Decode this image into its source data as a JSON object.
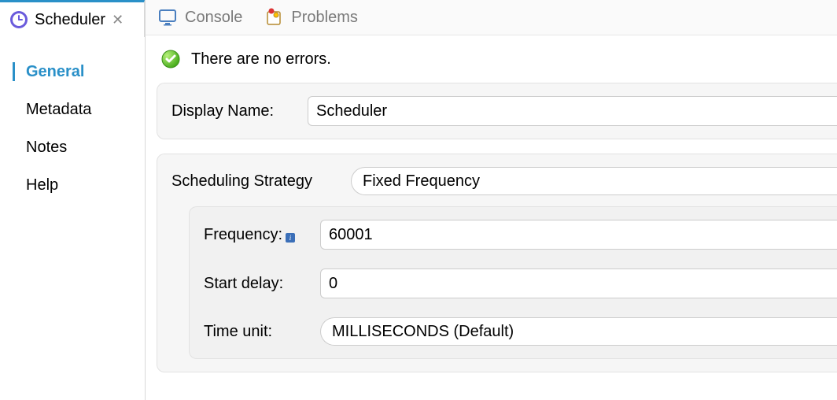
{
  "left": {
    "title": "Scheduler",
    "nav": {
      "general": "General",
      "metadata": "Metadata",
      "notes": "Notes",
      "help": "Help"
    }
  },
  "topTabs": {
    "console": "Console",
    "problems": "Problems"
  },
  "status": {
    "message": "There are no errors."
  },
  "form": {
    "displayNameLabel": "Display Name:",
    "displayName": "Scheduler",
    "schedulingStrategyLabel": "Scheduling Strategy",
    "schedulingStrategy": "Fixed Frequency",
    "frequencyLabel": "Frequency:",
    "frequency": "60001",
    "startDelayLabel": "Start delay:",
    "startDelay": "0",
    "timeUnitLabel": "Time unit:",
    "timeUnit": "MILLISECONDS (Default)"
  }
}
